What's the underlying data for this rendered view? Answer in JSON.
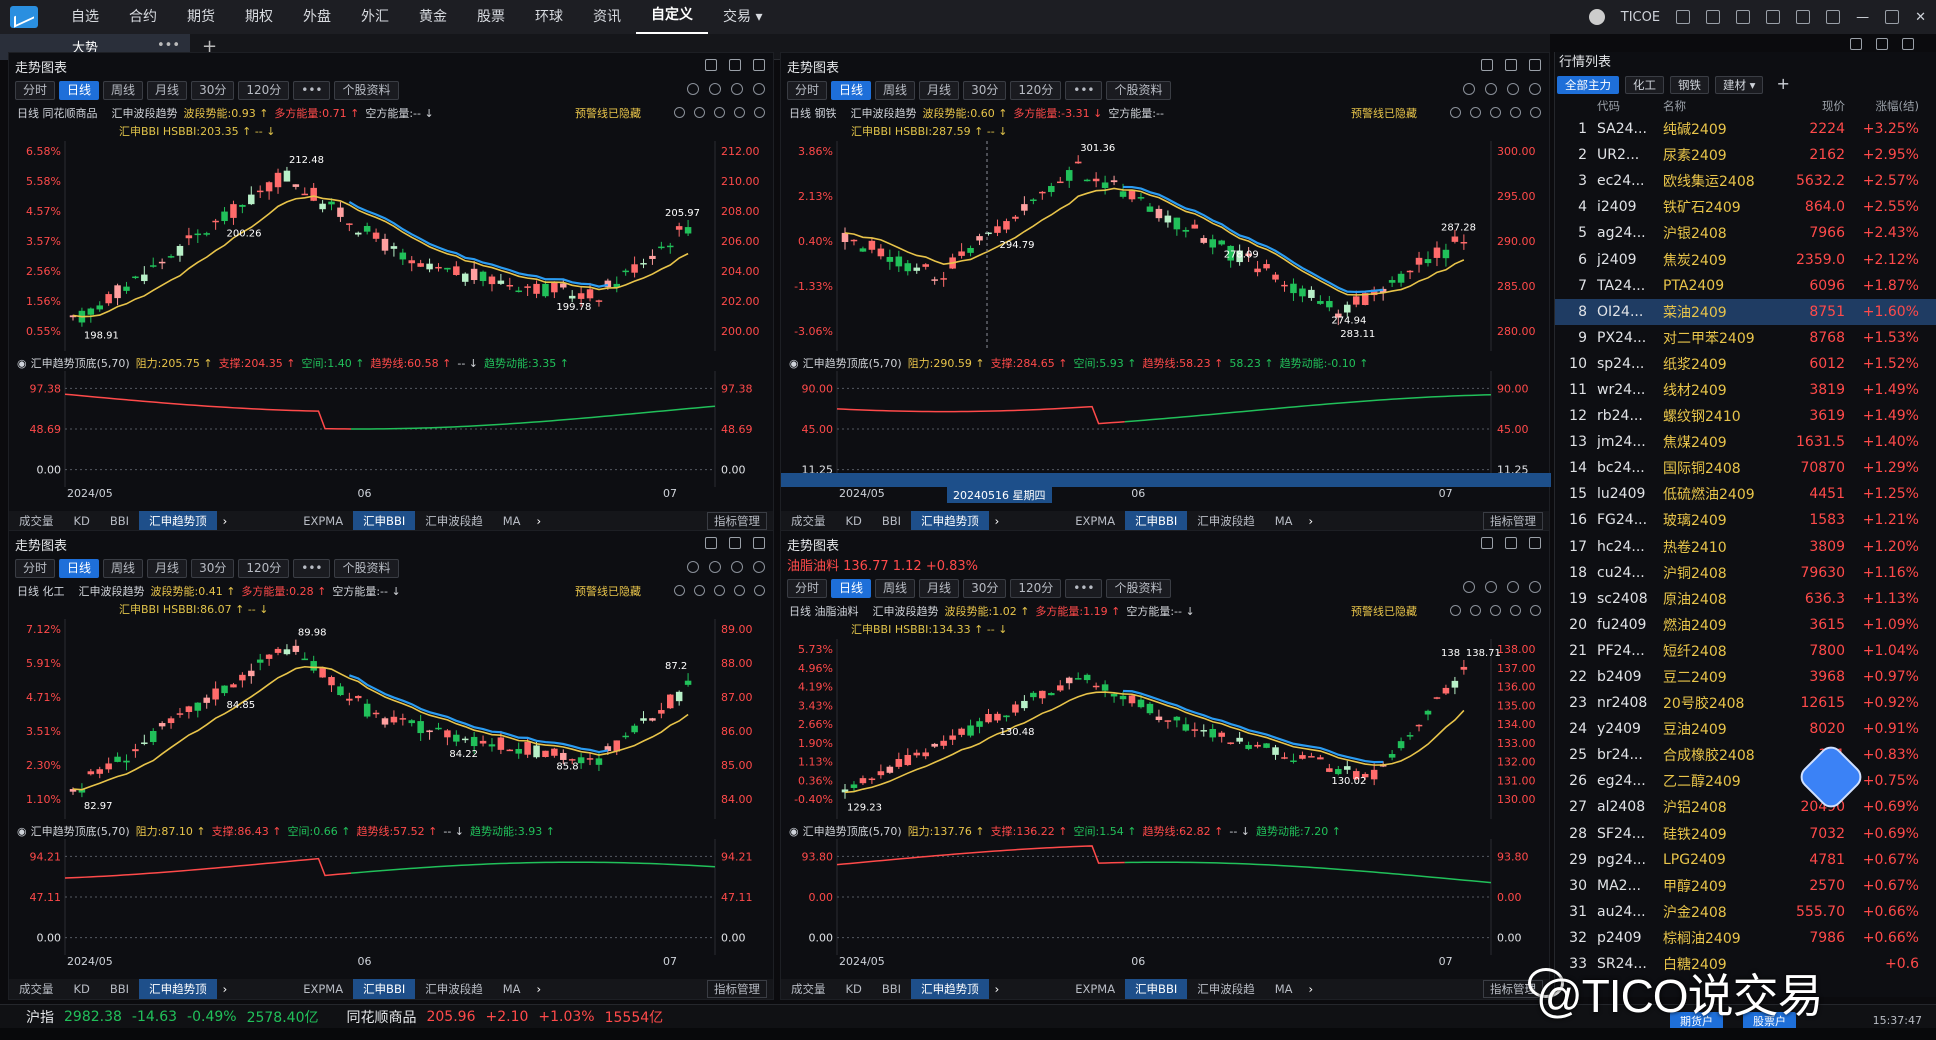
{
  "menu": {
    "items": [
      "自选",
      "合约",
      "期货",
      "期权",
      "外盘",
      "外汇",
      "黄金",
      "股票",
      "环球",
      "资讯",
      "自定义",
      "交易 ▾"
    ],
    "active": "自定义",
    "account": "TICOE"
  },
  "tabbar": {
    "tab": "大势",
    "dots": "•••",
    "add": "+"
  },
  "panels": [
    {
      "title": "走势图表",
      "quote": "",
      "tools": [
        "分时",
        "日线",
        "周线",
        "月线",
        "30分",
        "120分",
        "•••",
        "个股资料"
      ],
      "selected": "日线",
      "ind1_name": "日线 同花顺商品",
      "ind1": [
        [
          "汇申波段趋势",
          ""
        ],
        [
          "波段势能:0.93 ↑",
          "y"
        ],
        [
          "多方能量:0.71 ↑",
          "g"
        ],
        [
          "空方能量:-- ↓",
          "w"
        ]
      ],
      "ind2": "汇申BBI HSBBI:203.35 ↑ -- ↓",
      "warn": "预警线已隐藏",
      "left_axis": [
        "6.58%",
        "5.58%",
        "4.57%",
        "3.57%",
        "2.56%",
        "1.56%",
        "0.55%"
      ],
      "right_axis": [
        "212.00",
        "210.00",
        "208.00",
        "206.00",
        "204.00",
        "202.00",
        "200.00"
      ],
      "annotations": [
        [
          "212.48",
          "hi"
        ],
        [
          "198.91",
          "lo"
        ],
        [
          "205.97",
          "last"
        ],
        [
          "200.26",
          "m1"
        ],
        [
          "199.78",
          "m2"
        ]
      ],
      "sub_head": [
        [
          "汇申趋势顶底(5,70)",
          "w"
        ],
        [
          "阻力:205.75 ↑",
          "y"
        ],
        [
          "支撑:204.35 ↑",
          "r"
        ],
        [
          "空间:1.40 ↑",
          "g"
        ],
        [
          "趋势线:60.58 ↑",
          "r"
        ],
        [
          "-- ↓",
          "w"
        ],
        [
          "趋势动能:3.35 ↑",
          "g"
        ]
      ],
      "sub_axis": [
        "97.38",
        "48.69",
        "0.00"
      ],
      "dates": [
        "2024/05",
        "06",
        "07"
      ],
      "bottom": [
        "成交量",
        "KD",
        "BBI",
        "汇申趋势顶",
        "›",
        "EXPMA",
        "汇申BBI",
        "汇申波段趋",
        "MA",
        "›"
      ],
      "bottom_sel": [
        "汇申趋势顶",
        "汇申BBI"
      ],
      "mgmt": "指标管理"
    },
    {
      "title": "走势图表",
      "quote": "",
      "tools": [
        "分时",
        "日线",
        "周线",
        "月线",
        "30分",
        "120分",
        "•••",
        "个股资料"
      ],
      "selected": "日线",
      "ind1_name": "日线 钢铁",
      "ind1": [
        [
          "汇申波段趋势",
          ""
        ],
        [
          "波段势能:0.60 ↑",
          "y"
        ],
        [
          "多方能量:-3.31 ↓",
          "g"
        ],
        [
          "空方能量:--",
          "w"
        ]
      ],
      "ind2": "汇申BBI HSBBI:287.59 ↑ -- ↓",
      "warn": "预警线已隐藏",
      "left_axis": [
        "3.86%",
        "2.13%",
        "0.40%",
        "-1.33%",
        "-3.06%"
      ],
      "right_axis": [
        "300.00",
        "295.00",
        "290.00",
        "285.00",
        "280.00"
      ],
      "annotations": [
        [
          "301.36",
          "hi"
        ],
        [
          "283.11",
          "lo"
        ],
        [
          "287.28",
          "last"
        ],
        [
          "294.79",
          "m1"
        ],
        [
          "274.94",
          "m2"
        ],
        [
          "278.09",
          "m3"
        ]
      ],
      "sub_head": [
        [
          "汇申趋势顶底(5,70)",
          "w"
        ],
        [
          "阻力:290.59 ↑",
          "y"
        ],
        [
          "支撑:284.65 ↑",
          "r"
        ],
        [
          "空间:5.93 ↑",
          "g"
        ],
        [
          "趋势线:58.23 ↑",
          "r"
        ],
        [
          "58.23 ↑",
          "g"
        ],
        [
          "趋势动能:-0.10 ↑",
          "g"
        ]
      ],
      "sub_axis": [
        "90.00",
        "45.00",
        "11.25"
      ],
      "dates": [
        "2024/05",
        "06",
        "07"
      ],
      "crosshair": "20240516 星期四",
      "bottom": [
        "成交量",
        "KD",
        "BBI",
        "汇申趋势顶",
        "›",
        "EXPMA",
        "汇申BBI",
        "汇申波段趋",
        "MA",
        "›"
      ],
      "bottom_sel": [
        "汇申趋势顶",
        "汇申BBI"
      ],
      "mgmt": "指标管理"
    },
    {
      "title": "走势图表",
      "quote": "",
      "tools": [
        "分时",
        "日线",
        "周线",
        "月线",
        "30分",
        "120分",
        "•••",
        "个股资料"
      ],
      "selected": "日线",
      "ind1_name": "日线 化工",
      "ind1": [
        [
          "汇申波段趋势",
          ""
        ],
        [
          "波段势能:0.41 ↑",
          "y"
        ],
        [
          "多方能量:0.28 ↑",
          "g"
        ],
        [
          "空方能量:-- ↓",
          "w"
        ]
      ],
      "ind2": "汇申BBI HSBBI:86.07 ↑ -- ↓",
      "warn": "预警线已隐藏",
      "left_axis": [
        "7.12%",
        "5.91%",
        "4.71%",
        "3.51%",
        "2.30%",
        "1.10%"
      ],
      "right_axis": [
        "89.00",
        "88.00",
        "87.00",
        "86.00",
        "85.00",
        "84.00"
      ],
      "annotations": [
        [
          "89.98",
          "hi"
        ],
        [
          "82.97",
          "lo"
        ],
        [
          "87.2",
          "last"
        ],
        [
          "84.85",
          "m1"
        ],
        [
          "85.8",
          "m2"
        ],
        [
          "84.22",
          "m3"
        ]
      ],
      "sub_head": [
        [
          "汇申趋势顶底(5,70)",
          "w"
        ],
        [
          "阻力:87.10 ↑",
          "y"
        ],
        [
          "支撑:86.43 ↑",
          "r"
        ],
        [
          "空间:0.66 ↑",
          "g"
        ],
        [
          "趋势线:57.52 ↑",
          "r"
        ],
        [
          "-- ↓",
          "w"
        ],
        [
          "趋势动能:3.93 ↑",
          "g"
        ]
      ],
      "sub_axis": [
        "94.21",
        "47.11",
        "0.00"
      ],
      "dates": [
        "2024/05",
        "06",
        "07"
      ],
      "bottom": [
        "成交量",
        "KD",
        "BBI",
        "汇申趋势顶",
        "›",
        "EXPMA",
        "汇申BBI",
        "汇申波段趋",
        "MA",
        "›"
      ],
      "bottom_sel": [
        "汇申趋势顶",
        "汇申BBI"
      ],
      "mgmt": "指标管理"
    },
    {
      "title": "走势图表",
      "quote": "油脂油料  136.77  1.12  +0.83%",
      "tools": [
        "分时",
        "日线",
        "周线",
        "月线",
        "30分",
        "120分",
        "•••",
        "个股资料"
      ],
      "selected": "日线",
      "ind1_name": "日线 油脂油料",
      "ind1": [
        [
          "汇申波段趋势",
          ""
        ],
        [
          "波段势能:1.02 ↑",
          "y"
        ],
        [
          "多方能量:1.19 ↑",
          "g"
        ],
        [
          "空方能量:-- ↓",
          "w"
        ]
      ],
      "ind2": "汇申BBI HSBBI:134.33 ↑ -- ↓",
      "warn": "预警线已隐藏",
      "left_axis": [
        "5.73%",
        "4.96%",
        "4.19%",
        "3.43%",
        "2.66%",
        "1.90%",
        "1.13%",
        "0.36%",
        "-0.40%"
      ],
      "right_axis": [
        "138.00",
        "137.00",
        "136.00",
        "135.00",
        "134.00",
        "133.00",
        "132.00",
        "131.00",
        "130.00"
      ],
      "annotations": [
        [
          "138.71",
          "hi"
        ],
        [
          "129.23",
          "lo"
        ],
        [
          "138",
          "last"
        ],
        [
          "130.48",
          "m1"
        ],
        [
          "130.02",
          "m2"
        ]
      ],
      "sub_head": [
        [
          "汇申趋势顶底(5,70)",
          "w"
        ],
        [
          "阻力:137.76 ↑",
          "y"
        ],
        [
          "支撑:136.22 ↑",
          "r"
        ],
        [
          "空间:1.54 ↑",
          "g"
        ],
        [
          "趋势线:62.82 ↑",
          "r"
        ],
        [
          "-- ↓",
          "w"
        ],
        [
          "趋势动能:7.20 ↑",
          "g"
        ]
      ],
      "sub_axis": [
        "93.80",
        "0.00",
        "0.00"
      ],
      "dates": [
        "2024/05",
        "06",
        "07"
      ],
      "bottom": [
        "成交量",
        "KD",
        "BBI",
        "汇申趋势顶",
        "›",
        "EXPMA",
        "汇申BBI",
        "汇申波段趋",
        "MA",
        "›"
      ],
      "bottom_sel": [
        "汇申趋势顶",
        "汇申BBI"
      ],
      "mgmt": "指标管理"
    }
  ],
  "quote_list": {
    "title": "行情列表",
    "tabs": [
      "全部主力",
      "化工",
      "钢铁",
      "建材 ▾",
      "+"
    ],
    "tab_selected": "全部主力",
    "headers": [
      "代码",
      "名称",
      "现价",
      "涨幅(结)"
    ],
    "rows": [
      [
        "1",
        "SA24...",
        "纯碱2409",
        "2224",
        "+3.25%"
      ],
      [
        "2",
        "UR2...",
        "尿素2409",
        "2162",
        "+2.95%"
      ],
      [
        "3",
        "ec24...",
        "欧线集运2408",
        "5632.2",
        "+2.57%"
      ],
      [
        "4",
        "i2409",
        "铁矿石2409",
        "864.0",
        "+2.55%"
      ],
      [
        "5",
        "ag24...",
        "沪银2408",
        "7966",
        "+2.43%"
      ],
      [
        "6",
        "j2409",
        "焦炭2409",
        "2359.0",
        "+2.12%"
      ],
      [
        "7",
        "TA24...",
        "PTA2409",
        "6096",
        "+1.87%"
      ],
      [
        "8",
        "OI24...",
        "菜油2409",
        "8751",
        "+1.60%"
      ],
      [
        "9",
        "PX24...",
        "对二甲苯2409",
        "8768",
        "+1.53%"
      ],
      [
        "10",
        "sp24...",
        "纸浆2409",
        "6012",
        "+1.52%"
      ],
      [
        "11",
        "wr24...",
        "线材2409",
        "3819",
        "+1.49%"
      ],
      [
        "12",
        "rb24...",
        "螺纹钢2410",
        "3619",
        "+1.49%"
      ],
      [
        "13",
        "jm24...",
        "焦煤2409",
        "1631.5",
        "+1.40%"
      ],
      [
        "14",
        "bc24...",
        "国际铜2408",
        "70870",
        "+1.29%"
      ],
      [
        "15",
        "lu2409",
        "低硫燃油2409",
        "4451",
        "+1.25%"
      ],
      [
        "16",
        "FG24...",
        "玻璃2409",
        "1583",
        "+1.21%"
      ],
      [
        "17",
        "hc24...",
        "热卷2410",
        "3809",
        "+1.20%"
      ],
      [
        "18",
        "cu24...",
        "沪铜2408",
        "79630",
        "+1.16%"
      ],
      [
        "19",
        "sc2408",
        "原油2408",
        "636.3",
        "+1.13%"
      ],
      [
        "20",
        "fu2409",
        "燃油2409",
        "3615",
        "+1.09%"
      ],
      [
        "21",
        "PF24...",
        "短纤2408",
        "7800",
        "+1.04%"
      ],
      [
        "22",
        "b2409",
        "豆二2409",
        "3968",
        "+0.97%"
      ],
      [
        "23",
        "nr2408",
        "20号胶2408",
        "12615",
        "+0.92%"
      ],
      [
        "24",
        "y2409",
        "豆油2409",
        "8020",
        "+0.91%"
      ],
      [
        "25",
        "br24...",
        "合成橡胶2408",
        "151",
        "+0.83%"
      ],
      [
        "26",
        "eg24...",
        "乙二醇2409",
        "47",
        "+0.75%"
      ],
      [
        "27",
        "al2408",
        "沪铝2408",
        "20490",
        "+0.69%"
      ],
      [
        "28",
        "SF24...",
        "硅铁2409",
        "7032",
        "+0.69%"
      ],
      [
        "29",
        "pg24...",
        "LPG2409",
        "4781",
        "+0.67%"
      ],
      [
        "30",
        "MA2...",
        "甲醇2409",
        "2570",
        "+0.67%"
      ],
      [
        "31",
        "au24...",
        "沪金2408",
        "555.70",
        "+0.66%"
      ],
      [
        "32",
        "p2409",
        "棕榈油2409",
        "7986",
        "+0.66%"
      ],
      [
        "33",
        "SR24...",
        "白糖2409",
        "",
        "+0.6"
      ]
    ],
    "selected_row": "8"
  },
  "status": {
    "idx1_name": "沪指",
    "idx1_val": "2982.38",
    "idx1_chg": "-14.63",
    "idx1_pct": "-0.49%",
    "idx1_amt": "2578.40亿",
    "idx2_name": "同花顺商品",
    "idx2_val": "205.96",
    "idx2_chg": "+2.10",
    "idx2_pct": "+1.03%",
    "idx2_amt": "15554亿",
    "btn1": "期货户",
    "btn2": "股票户",
    "time": "15:37:47"
  },
  "watermark": "@TICO说交易",
  "colors": {
    "up": "#ff4a4a",
    "down": "#21c05a",
    "bbi": "#e8c44a",
    "trend_blue": "#2b9cf2",
    "accent": "#1e6fd9"
  },
  "chart_data": [
    {
      "type": "candlestick",
      "name": "同花顺商品",
      "ylim": [
        198,
        213
      ],
      "annotations": {
        "high": 212.48,
        "low": 198.91,
        "last": 205.97
      }
    },
    {
      "type": "candlestick",
      "name": "钢铁",
      "ylim": [
        274,
        302
      ],
      "annotations": {
        "high": 301.36,
        "low": 274.94,
        "last": 287.28
      }
    },
    {
      "type": "candlestick",
      "name": "化工",
      "ylim": [
        82.5,
        90.3
      ],
      "annotations": {
        "high": 89.98,
        "low": 82.97,
        "last": 87.2
      }
    },
    {
      "type": "candlestick",
      "name": "油脂油料",
      "ylim": [
        129,
        139
      ],
      "annotations": {
        "high": 138.71,
        "low": 129.23,
        "last": 138
      }
    }
  ]
}
